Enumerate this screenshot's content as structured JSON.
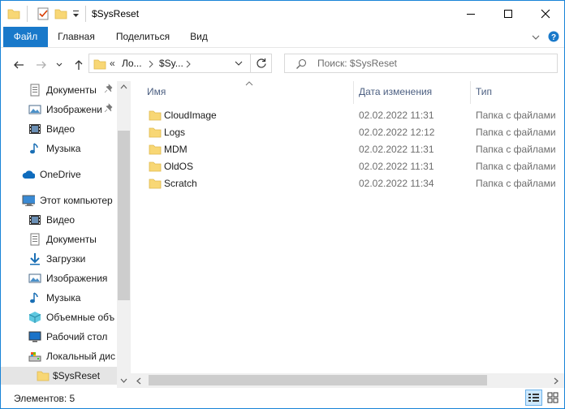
{
  "window": {
    "title": "$SysReset"
  },
  "ribbon": {
    "tabs": [
      "Файл",
      "Главная",
      "Поделиться",
      "Вид"
    ]
  },
  "address": {
    "chevron": "«",
    "parts": [
      "Ло...",
      "$Sy..."
    ]
  },
  "search": {
    "placeholder": "Поиск: $SysReset"
  },
  "nav": {
    "quick": [
      {
        "label": "Документы",
        "icon": "documents-icon",
        "pinned": true
      },
      {
        "label": "Изображени",
        "icon": "pictures-icon",
        "pinned": true
      },
      {
        "label": "Видео",
        "icon": "video-icon",
        "pinned": false
      },
      {
        "label": "Музыка",
        "icon": "music-icon",
        "pinned": false
      }
    ],
    "onedrive": "OneDrive",
    "pc": "Этот компьютер",
    "pc_items": [
      {
        "label": "Видео",
        "icon": "video-icon"
      },
      {
        "label": "Документы",
        "icon": "documents-icon"
      },
      {
        "label": "Загрузки",
        "icon": "downloads-icon"
      },
      {
        "label": "Изображения",
        "icon": "pictures-icon"
      },
      {
        "label": "Музыка",
        "icon": "music-icon"
      },
      {
        "label": "Объемные объ",
        "icon": "3d-objects-icon"
      },
      {
        "label": "Рабочий стол",
        "icon": "desktop-icon"
      },
      {
        "label": "Локальный дис",
        "icon": "local-disk-icon"
      }
    ],
    "selected": "$SysReset"
  },
  "columns": {
    "name": "Имя",
    "date": "Дата изменения",
    "type": "Тип"
  },
  "files": [
    {
      "name": "CloudImage",
      "date": "02.02.2022 11:31",
      "type": "Папка с файлами"
    },
    {
      "name": "Logs",
      "date": "02.02.2022 12:12",
      "type": "Папка с файлами"
    },
    {
      "name": "MDM",
      "date": "02.02.2022 11:31",
      "type": "Папка с файлами"
    },
    {
      "name": "OldOS",
      "date": "02.02.2022 11:31",
      "type": "Папка с файлами"
    },
    {
      "name": "Scratch",
      "date": "02.02.2022 11:34",
      "type": "Папка с файлами"
    }
  ],
  "status": {
    "count": "Элементов: 5"
  },
  "colors": {
    "accent": "#1979ca",
    "folder": "#f8d775",
    "selected": "#e5e5e5"
  }
}
